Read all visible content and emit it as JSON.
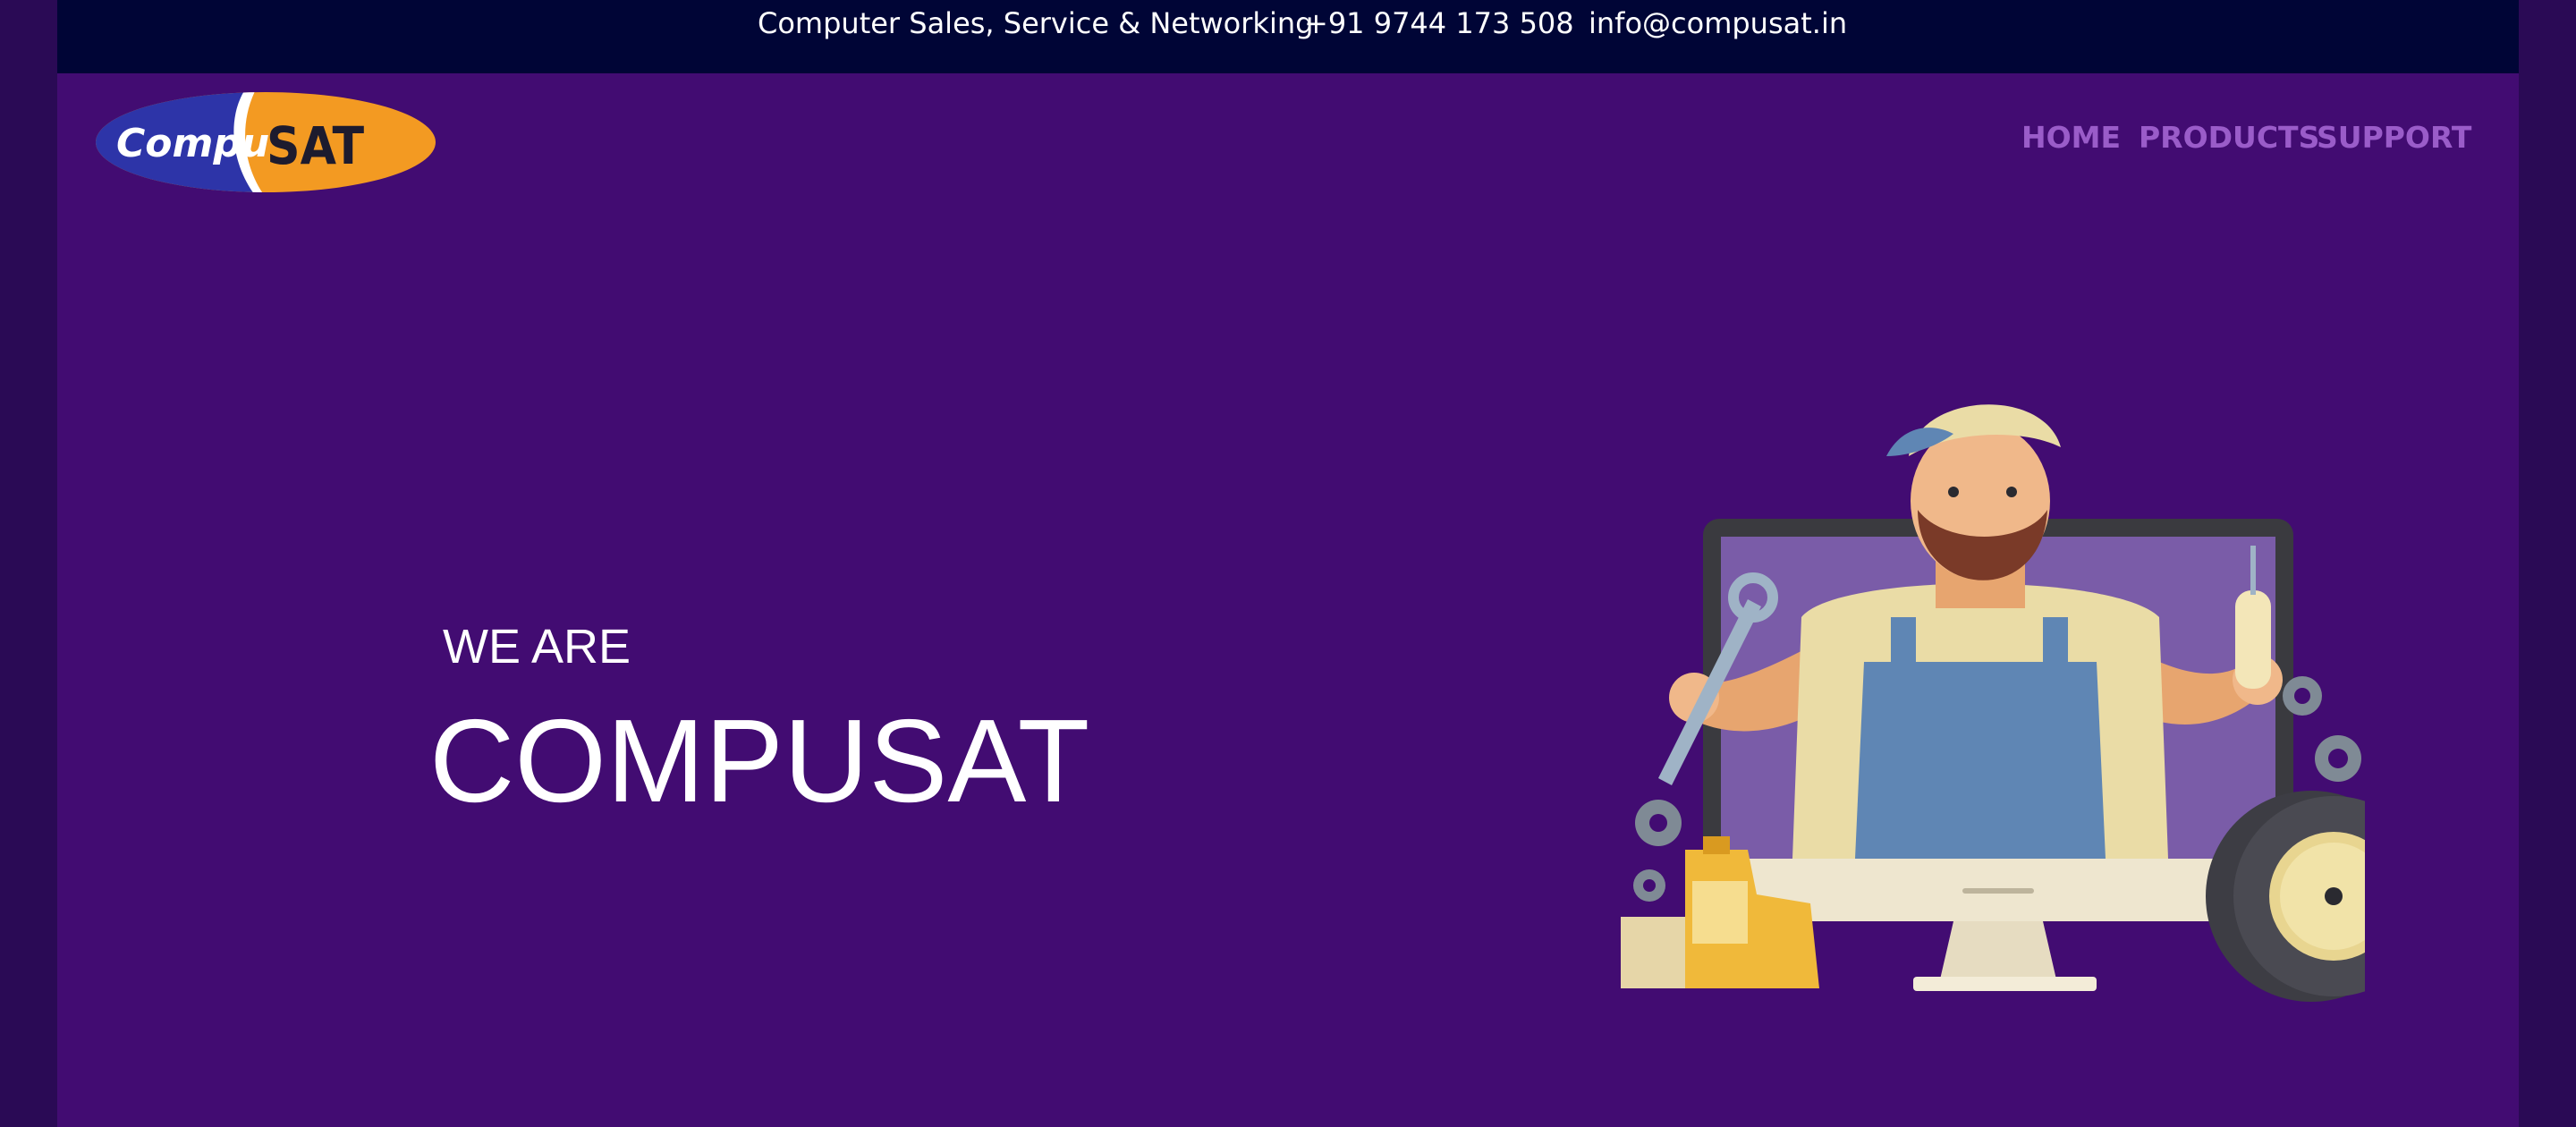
{
  "topbar": {
    "tagline": "Computer Sales, Service & Networking",
    "phone": "+91 9744 173 508",
    "email": "info@compusat.in"
  },
  "logo": {
    "part1": "Compu",
    "part2": "SAT"
  },
  "nav": {
    "home": "HOME",
    "products": "PRODUCTS",
    "support": "SUPPORT"
  },
  "hero": {
    "eyebrow": "WE ARE",
    "title": "COMPUSAT"
  },
  "colors": {
    "page_bg": "#420c72",
    "topbar_bg": "#000536",
    "nav_text": "#9a5cc9",
    "logo_blue": "#2d34a8",
    "logo_orange": "#f39a22"
  }
}
